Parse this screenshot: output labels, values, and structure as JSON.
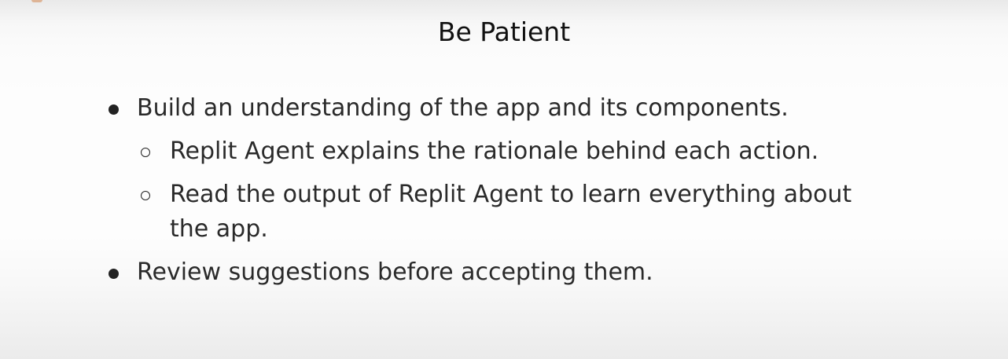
{
  "slide": {
    "title": "Be Patient",
    "bullets": [
      {
        "level": 1,
        "text": "Build an understanding of the app and its components."
      },
      {
        "level": 2,
        "text": "Replit Agent explains the rationale behind each action."
      },
      {
        "level": 2,
        "text": "Read the output of Replit Agent to learn everything about the app."
      },
      {
        "level": 1,
        "text": "Review suggestions before accepting them."
      }
    ]
  }
}
